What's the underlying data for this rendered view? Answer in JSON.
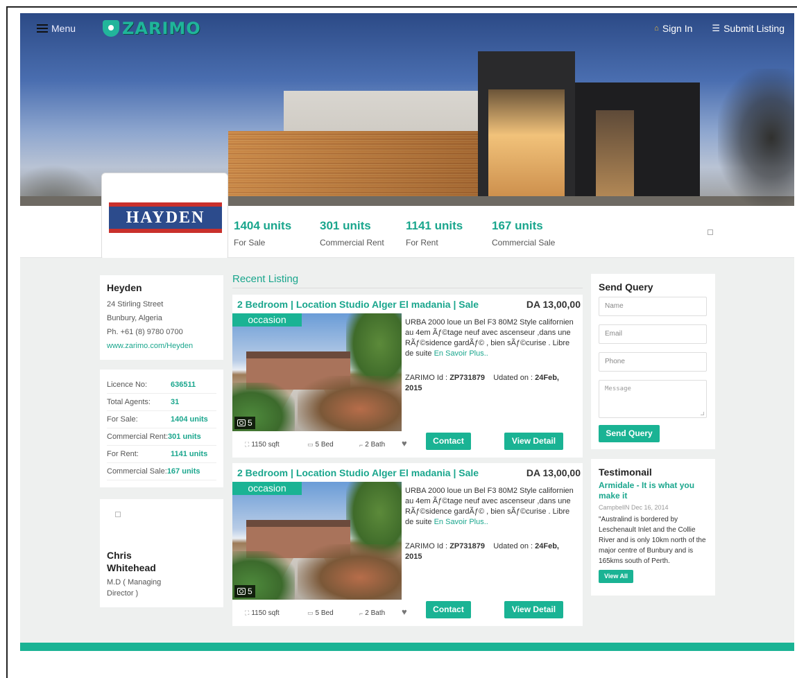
{
  "nav": {
    "menu_label": "Menu",
    "logo_text": "ZARIMO",
    "sign_in": "Sign In",
    "submit_listing": "Submit Listing"
  },
  "company": {
    "logo_text": "HAYDEN",
    "stats": [
      {
        "value": "1404 units",
        "label": "For Sale"
      },
      {
        "value": "301 units",
        "label": "Commercial Rent"
      },
      {
        "value": "1141 units",
        "label": "For Rent"
      },
      {
        "value": "167 units",
        "label": "Commercial Sale"
      }
    ]
  },
  "agency": {
    "name": "Heyden",
    "address1": "24 Stirling Street",
    "address2": "Bunbury, Algeria",
    "phone": "Ph. +61 (8) 9780 0700",
    "website": "www.zarimo.com/Heyden"
  },
  "details": [
    {
      "key": "Licence No:",
      "value": "636511"
    },
    {
      "key": "Total Agents:",
      "value": "31"
    },
    {
      "key": "For Sale:",
      "value": "1404 units"
    },
    {
      "key": "Commercial Rent:",
      "value": "301 units"
    },
    {
      "key": "For Rent:",
      "value": "1141 units"
    },
    {
      "key": "Commercial Sale:",
      "value": "167 units"
    }
  ],
  "agent": {
    "name_line1": "Chris",
    "name_line2": "Whitehead",
    "role_line1": "M.D ( Managing",
    "role_line2": "Director )"
  },
  "recent": {
    "heading": "Recent Listing",
    "listings": [
      {
        "title": "2 Bedroom | Location Studio Alger El madania | Sale",
        "price": "DA 13,00,00",
        "badge": "occasion",
        "photo_count": "5",
        "description": "URBA 2000 loue un Bel F3 80M2 Style californien au 4em Ãƒ©tage neuf avec ascenseur ,dans une RÃƒ©sidence gardÃƒ© , bien sÃƒ©curise . Libre de suite",
        "more_link": "En Savoir Plus..",
        "id_label": "ZARIMO Id :",
        "id_value": "ZP731879",
        "updated_label": "Udated on :",
        "updated_value": "24Feb, 2015",
        "area": "1150 sqft",
        "beds": "5 Bed",
        "baths": "2 Bath",
        "contact_label": "Contact",
        "view_label": "View Detail"
      },
      {
        "title": "2 Bedroom | Location Studio Alger El madania | Sale",
        "price": "DA 13,00,00",
        "badge": "occasion",
        "photo_count": "5",
        "description": "URBA 2000 loue un Bel F3 80M2 Style californien au 4em Ãƒ©tage neuf avec ascenseur ,dans une RÃƒ©sidence gardÃƒ© , bien sÃƒ©curise . Libre de suite",
        "more_link": "En Savoir Plus..",
        "id_label": "ZARIMO Id :",
        "id_value": "ZP731879",
        "updated_label": "Udated on :",
        "updated_value": "24Feb, 2015",
        "area": "1150 sqft",
        "beds": "5 Bed",
        "baths": "2 Bath",
        "contact_label": "Contact",
        "view_label": "View Detail"
      }
    ]
  },
  "query": {
    "heading": "Send Query",
    "name_placeholder": "Name",
    "email_placeholder": "Email",
    "phone_placeholder": "Phone",
    "message_placeholder": "Message",
    "send_label": "Send Query"
  },
  "testimonial": {
    "heading": "Testimonail",
    "title": "Armidale - It is what you make it",
    "byline": "CampbellN Dec 16, 2014",
    "quote": "\"Australind is bordered by Leschenault Inlet and the Collie River and is only 10km north of the major centre of Bunbury and is 165kms south of Perth.",
    "view_all": "View All"
  },
  "colors": {
    "accent": "#1ab394",
    "accent_text": "#1aa68d",
    "panel_bg": "#eef0ef"
  }
}
